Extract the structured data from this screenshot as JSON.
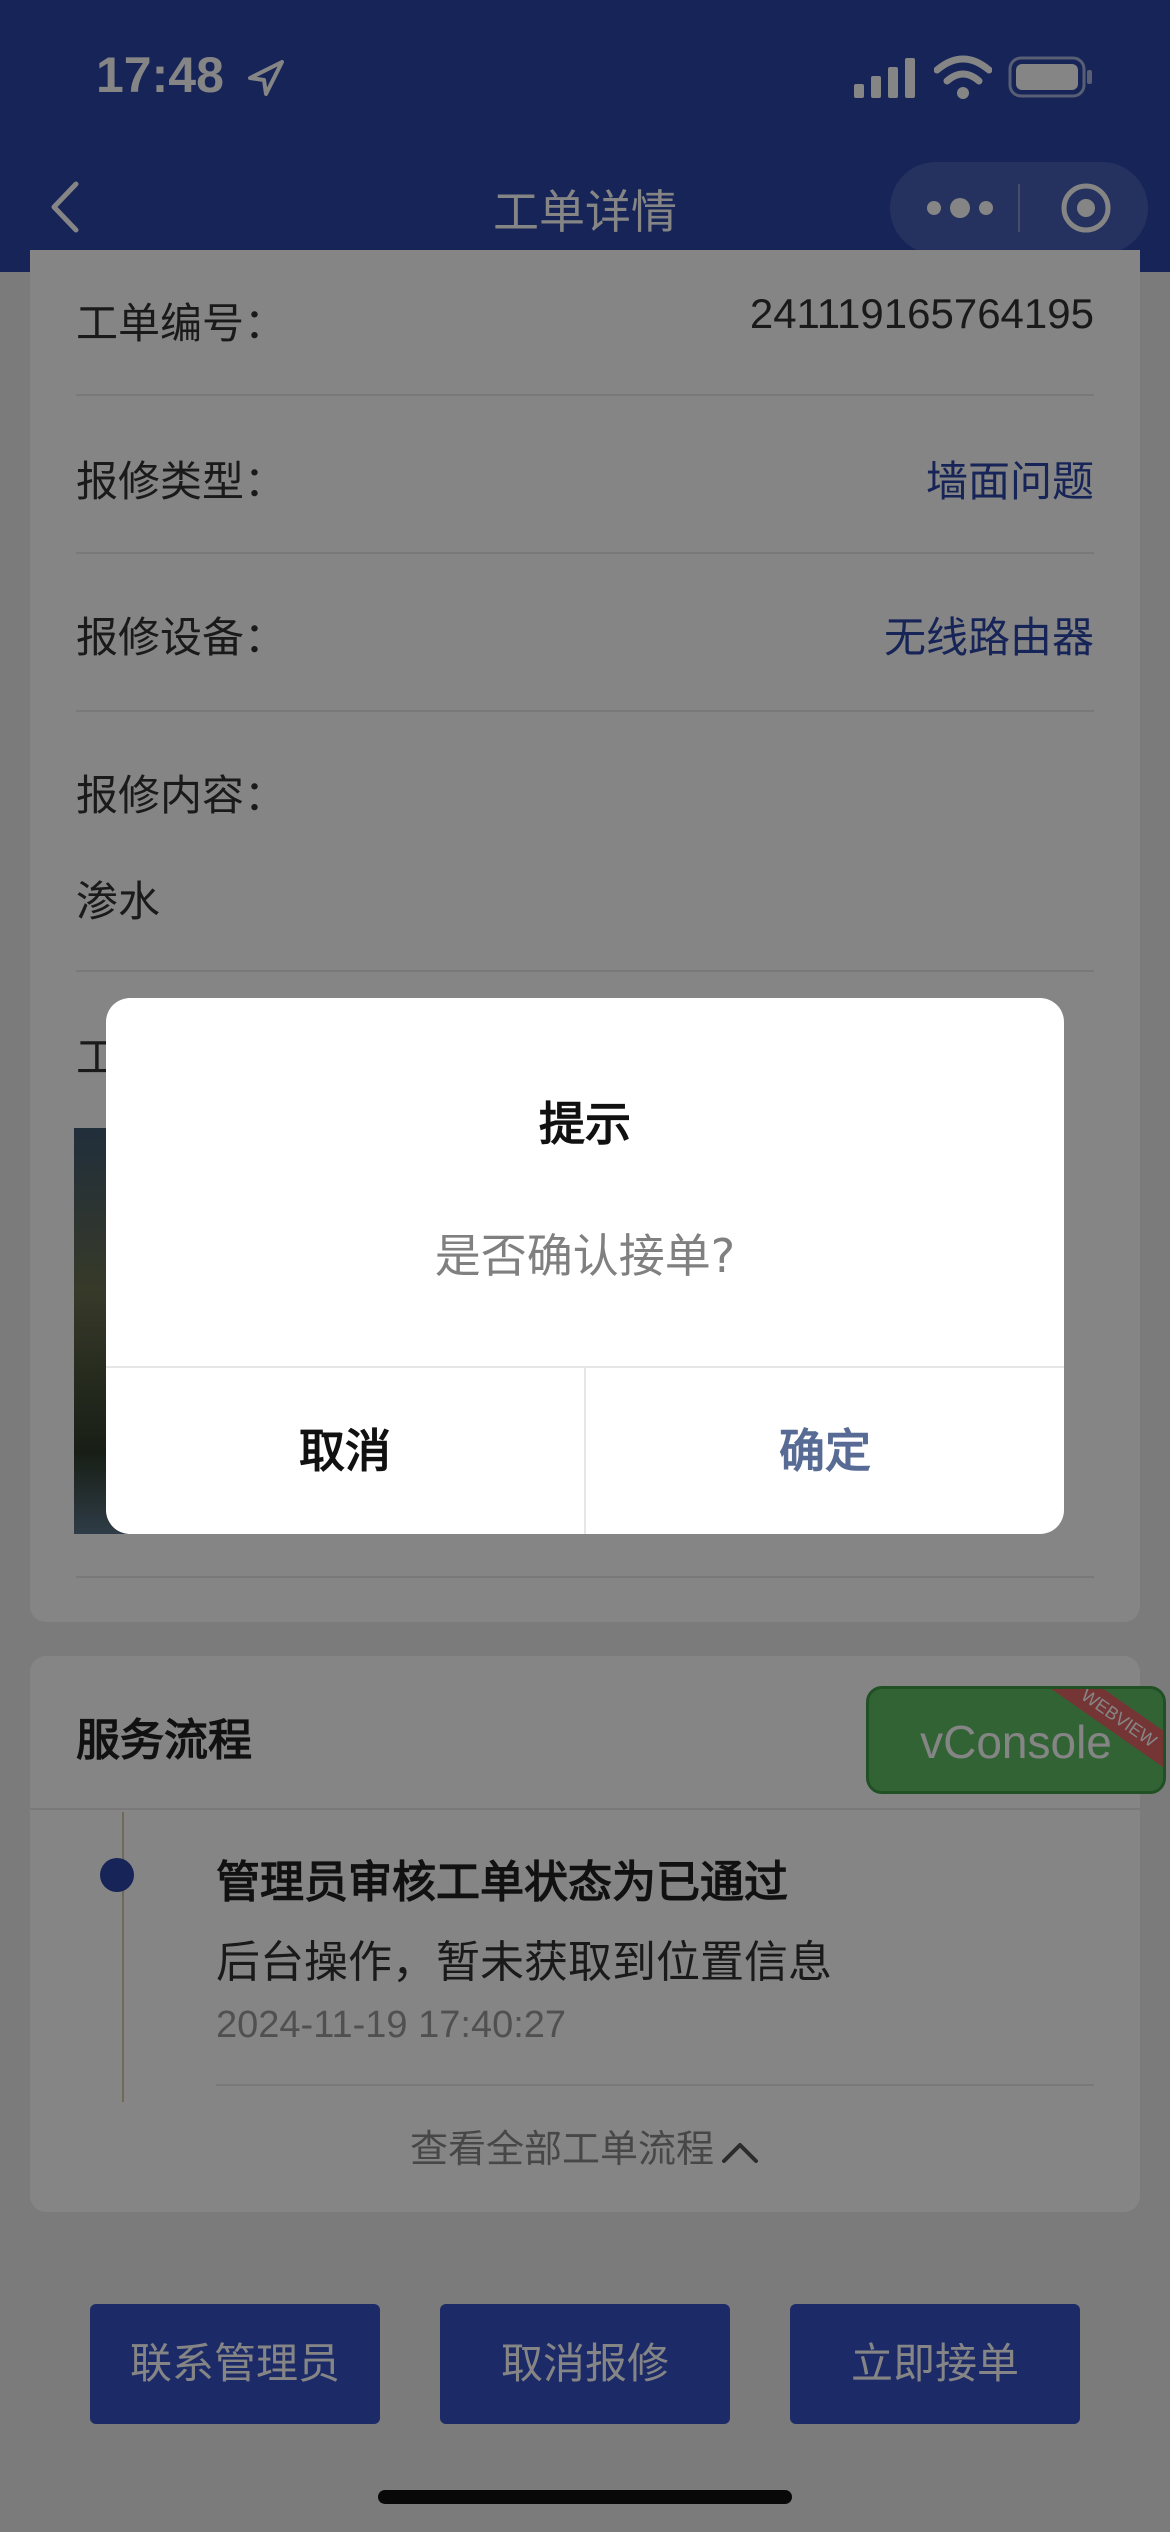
{
  "status_bar": {
    "time": "17:48"
  },
  "nav": {
    "title": "工单详情"
  },
  "order": {
    "rows": [
      {
        "label": "工单编号：",
        "value": "241119165764195"
      },
      {
        "label": "报修类型：",
        "value": "墙面问题"
      },
      {
        "label": "报修设备：",
        "value": "无线路由器"
      },
      {
        "label": "报修内容：",
        "value": "渗水"
      }
    ],
    "photo_label": "工"
  },
  "flow": {
    "title": "服务流程",
    "items": [
      {
        "head": "管理员审核工单状态为已通过",
        "desc": "后台操作，暂未获取到位置信息",
        "time": "2024-11-19 17:40:27"
      }
    ],
    "view_all": "查看全部工单流程"
  },
  "vconsole": {
    "label": "vConsole",
    "ribbon": "WEBVIEW"
  },
  "actions": {
    "contact": "联系管理员",
    "cancel_repair": "取消报修",
    "accept": "立即接单"
  },
  "dialog": {
    "title": "提示",
    "message": "是否确认接单?",
    "cancel": "取消",
    "confirm": "确定"
  },
  "colors": {
    "primary": "#2b45a8",
    "button": "#3651c7",
    "link": "#2b45a8",
    "confirm": "#576b95",
    "vconsole": "#61bf67"
  }
}
